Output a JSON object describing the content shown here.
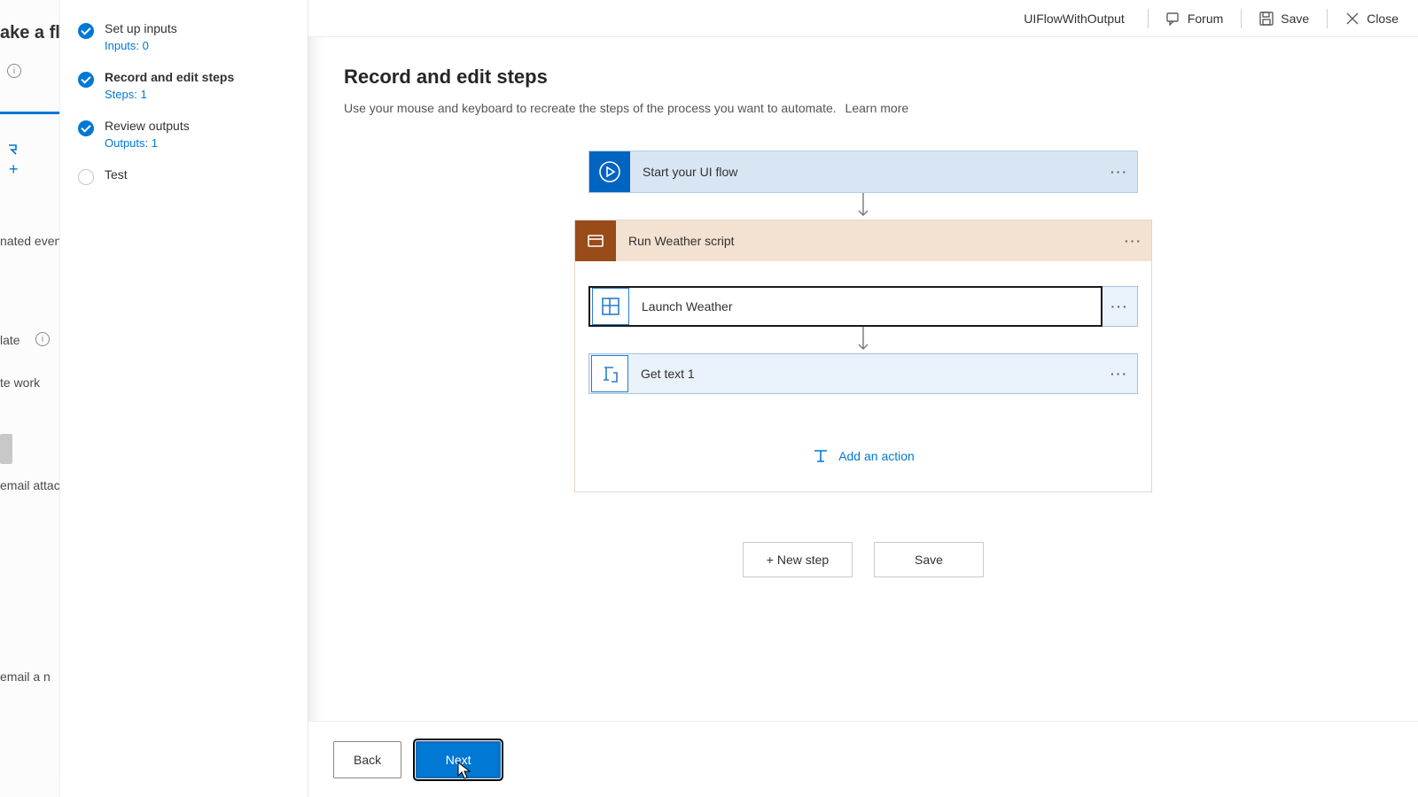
{
  "header": {
    "flowName": "UIFlowWithOutput",
    "forum": "Forum",
    "save": "Save",
    "close": "Close"
  },
  "wizard": {
    "steps": [
      {
        "title": "Set up inputs",
        "sub": "Inputs: 0",
        "state": "done"
      },
      {
        "title": "Record and edit steps",
        "sub": "Steps: 1",
        "state": "active"
      },
      {
        "title": "Review outputs",
        "sub": "Outputs: 1",
        "state": "done"
      },
      {
        "title": "Test",
        "sub": "",
        "state": "empty"
      }
    ]
  },
  "main": {
    "heading": "Record and edit steps",
    "description": "Use your mouse and keyboard to recreate the steps of the process you want to automate.",
    "learnMore": "Learn more",
    "startCard": "Start your UI flow",
    "scriptHeader": "Run Weather script",
    "launchCard": "Launch Weather",
    "getTextCard": "Get text 1",
    "addAction": "Add an action",
    "newStep": "+ New step",
    "saveBtn": "Save"
  },
  "footer": {
    "back": "Back",
    "next": "Next"
  },
  "backstrip": {
    "header": "ake a fl",
    "frag1": "nated even",
    "frag2": "late",
    "frag3": "te work",
    "frag4": "email attac",
    "frag5": "email a n"
  }
}
